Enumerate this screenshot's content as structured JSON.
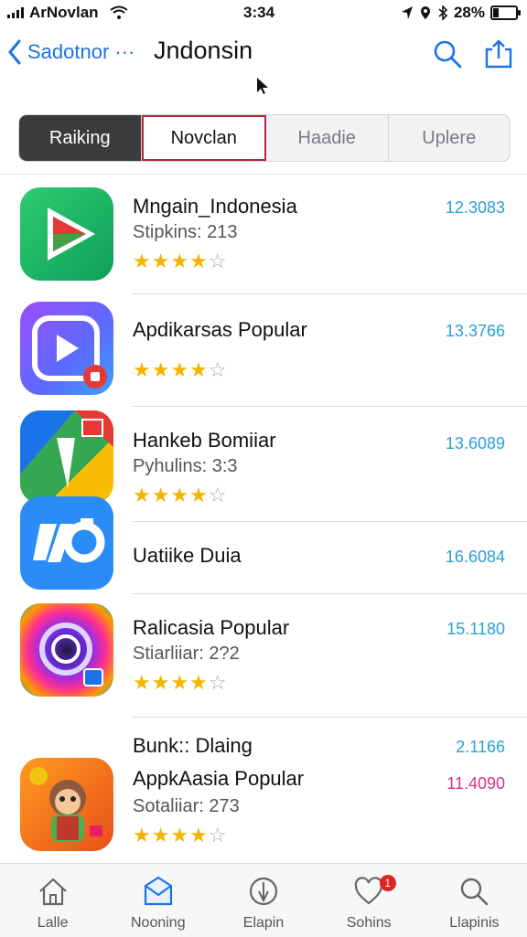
{
  "status": {
    "carrier": "ArNovlan",
    "time": "3:34",
    "battery": "28%",
    "battery_level": 0.28
  },
  "nav": {
    "back_label": "Sadotnor ···",
    "title": "Jndonsin"
  },
  "segments": [
    "Raiking",
    "Novclan",
    "Haadie",
    "Uplere"
  ],
  "apps": [
    {
      "title": "Mngain_Indonesia",
      "sub": "Stipkins: 213",
      "rating": 4,
      "value": "12.3083"
    },
    {
      "title": "Apdikarsas Popular",
      "sub": "",
      "rating": 4,
      "value": "13.3766"
    },
    {
      "title": "Hankeb Bomiiar",
      "sub": "Pyhulins: 3:3",
      "rating": 4,
      "value": "13.6089"
    },
    {
      "title": "Uatiike Duia",
      "sub": "",
      "rating": 0,
      "value": "16.6084"
    },
    {
      "title": "Ralicasia Popular",
      "sub": "Stiarliiar: 2?2",
      "rating": 4,
      "value": "15.1180"
    },
    {
      "title": "AppkAasia Popular",
      "pre_title": "Bunk:: Dlaing",
      "pre_value": "2.1166",
      "sub": "Sotaliiar: 273",
      "rating": 4,
      "value": "11.4090"
    }
  ],
  "tabs": [
    {
      "label": "Lalle",
      "icon": "home-icon"
    },
    {
      "label": "Nooning",
      "icon": "inbox-icon"
    },
    {
      "label": "Elapin",
      "icon": "compass-icon"
    },
    {
      "label": "Sohins",
      "icon": "heart-icon",
      "badge": "1"
    },
    {
      "label": "Llapinis",
      "icon": "search-icon"
    }
  ],
  "colors": {
    "accent": "#1a73e8",
    "value": "#2a9fd6",
    "value_alt": "#d63384",
    "star": "#f4b400",
    "segment_dark": "#3b3b3d"
  }
}
